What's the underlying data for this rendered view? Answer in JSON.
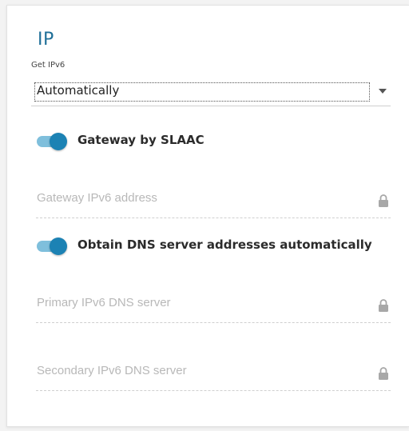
{
  "section": {
    "title": "IP"
  },
  "get_ipv6": {
    "label": "Get IPv6",
    "value": "Automatically"
  },
  "gateway_by_slaac": {
    "label": "Gateway by SLAAC",
    "enabled": true
  },
  "gateway_ipv6_address": {
    "placeholder": "Gateway IPv6 address",
    "icon": "lock-icon"
  },
  "obtain_dns_auto": {
    "label": "Obtain DNS server addresses automatically",
    "enabled": true
  },
  "primary_dns": {
    "placeholder": "Primary IPv6 DNS server",
    "icon": "lock-icon"
  },
  "secondary_dns": {
    "placeholder": "Secondary IPv6 DNS server",
    "icon": "lock-icon"
  },
  "colors": {
    "accent": "#1c82b4",
    "toggle_track": "#7fbfdc",
    "title": "#1f6f98",
    "placeholder": "#b8b8b8"
  }
}
